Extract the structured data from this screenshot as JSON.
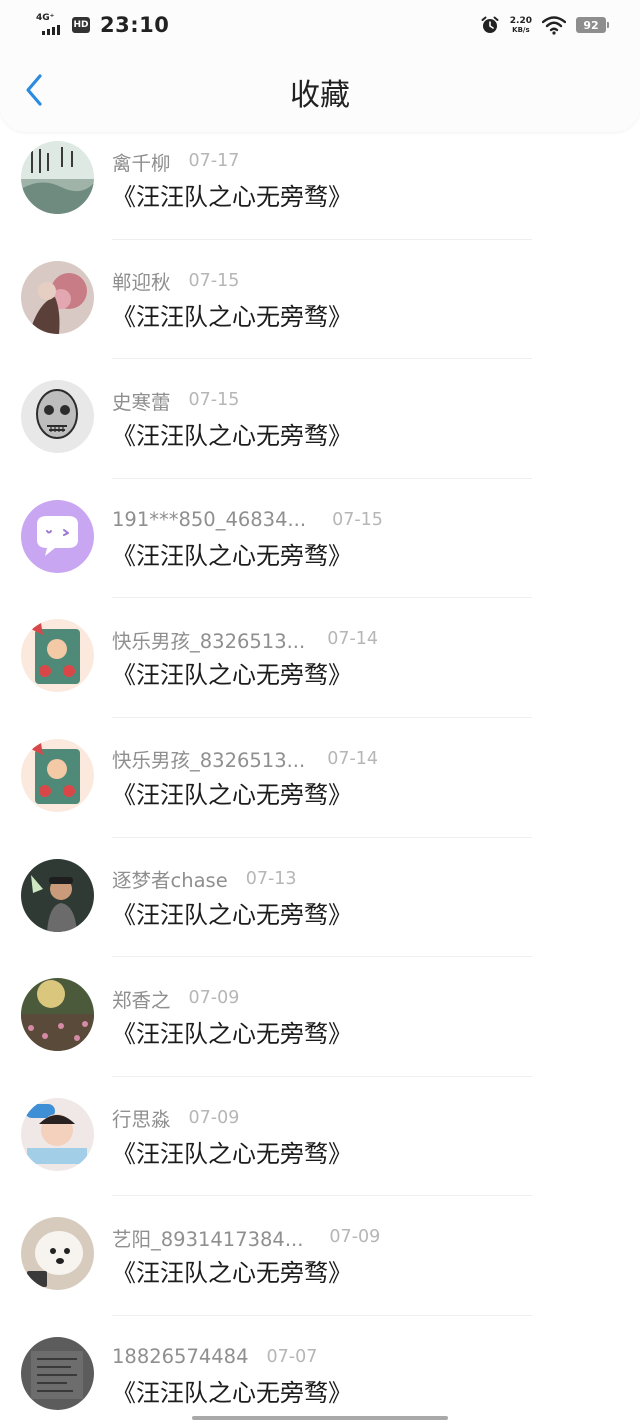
{
  "status_bar": {
    "network": "4G⁺",
    "hd_badge": "HD",
    "time": "23:10",
    "net_speed_value": "2.20",
    "net_speed_unit": "KB/s",
    "battery": "92",
    "icons": [
      "signal-icon",
      "alarm-icon",
      "wifi-icon",
      "battery-icon"
    ]
  },
  "nav": {
    "title": "收藏",
    "back_icon": "chevron-left-icon"
  },
  "colors": {
    "accent": "#2b8be0",
    "username": "#8f8f8f",
    "date": "#b6b6b6",
    "title": "#1c1c1c"
  },
  "favorites": [
    {
      "user": "禽千柳",
      "date": "07-17",
      "title": "《汪汪队之心无旁骛》"
    },
    {
      "user": "郸迎秋",
      "date": "07-15",
      "title": "《汪汪队之心无旁骛》"
    },
    {
      "user": "史寒蕾",
      "date": "07-15",
      "title": "《汪汪队之心无旁骛》"
    },
    {
      "user": "191***850_46834...",
      "date": "07-15",
      "title": "《汪汪队之心无旁骛》"
    },
    {
      "user": "快乐男孩_8326513...",
      "date": "07-14",
      "title": "《汪汪队之心无旁骛》"
    },
    {
      "user": "快乐男孩_8326513...",
      "date": "07-14",
      "title": "《汪汪队之心无旁骛》"
    },
    {
      "user": "逐梦者chase",
      "date": "07-13",
      "title": "《汪汪队之心无旁骛》"
    },
    {
      "user": "郑香之",
      "date": "07-09",
      "title": "《汪汪队之心无旁骛》"
    },
    {
      "user": "行思淼",
      "date": "07-09",
      "title": "《汪汪队之心无旁骛》"
    },
    {
      "user": "艺阳_8931417384...",
      "date": "07-09",
      "title": "《汪汪队之心无旁骛》"
    },
    {
      "user": "18826574484",
      "date": "07-07",
      "title": "《汪汪队之心无旁骛》"
    }
  ]
}
